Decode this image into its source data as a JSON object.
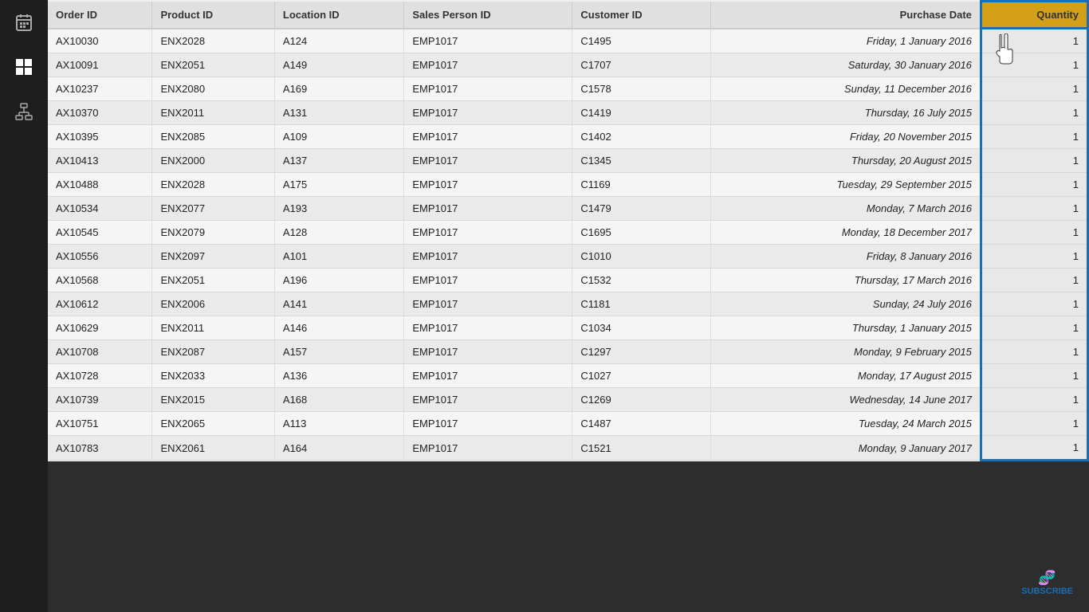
{
  "sidebar": {
    "icons": [
      {
        "name": "calendar-icon",
        "symbol": "📅"
      },
      {
        "name": "table-icon",
        "symbol": "⊞"
      },
      {
        "name": "hierarchy-icon",
        "symbol": "⊟"
      }
    ]
  },
  "table": {
    "columns": [
      {
        "key": "order_id",
        "label": "Order ID",
        "align": "left"
      },
      {
        "key": "product_id",
        "label": "Product ID",
        "align": "left"
      },
      {
        "key": "location_id",
        "label": "Location ID",
        "align": "left"
      },
      {
        "key": "sales_person_id",
        "label": "Sales Person ID",
        "align": "left"
      },
      {
        "key": "customer_id",
        "label": "Customer ID",
        "align": "left"
      },
      {
        "key": "purchase_date",
        "label": "Purchase Date",
        "align": "right"
      },
      {
        "key": "quantity",
        "label": "Quantity",
        "align": "right"
      }
    ],
    "rows": [
      {
        "order_id": "AX10030",
        "product_id": "ENX2028",
        "location_id": "A124",
        "sales_person_id": "EMP1017",
        "customer_id": "C1495",
        "purchase_date": "Friday, 1 January 2016",
        "quantity": "1"
      },
      {
        "order_id": "AX10091",
        "product_id": "ENX2051",
        "location_id": "A149",
        "sales_person_id": "EMP1017",
        "customer_id": "C1707",
        "purchase_date": "Saturday, 30 January 2016",
        "quantity": "1"
      },
      {
        "order_id": "AX10237",
        "product_id": "ENX2080",
        "location_id": "A169",
        "sales_person_id": "EMP1017",
        "customer_id": "C1578",
        "purchase_date": "Sunday, 11 December 2016",
        "quantity": "1"
      },
      {
        "order_id": "AX10370",
        "product_id": "ENX2011",
        "location_id": "A131",
        "sales_person_id": "EMP1017",
        "customer_id": "C1419",
        "purchase_date": "Thursday, 16 July 2015",
        "quantity": "1"
      },
      {
        "order_id": "AX10395",
        "product_id": "ENX2085",
        "location_id": "A109",
        "sales_person_id": "EMP1017",
        "customer_id": "C1402",
        "purchase_date": "Friday, 20 November 2015",
        "quantity": "1"
      },
      {
        "order_id": "AX10413",
        "product_id": "ENX2000",
        "location_id": "A137",
        "sales_person_id": "EMP1017",
        "customer_id": "C1345",
        "purchase_date": "Thursday, 20 August 2015",
        "quantity": "1"
      },
      {
        "order_id": "AX10488",
        "product_id": "ENX2028",
        "location_id": "A175",
        "sales_person_id": "EMP1017",
        "customer_id": "C1169",
        "purchase_date": "Tuesday, 29 September 2015",
        "quantity": "1"
      },
      {
        "order_id": "AX10534",
        "product_id": "ENX2077",
        "location_id": "A193",
        "sales_person_id": "EMP1017",
        "customer_id": "C1479",
        "purchase_date": "Monday, 7 March 2016",
        "quantity": "1"
      },
      {
        "order_id": "AX10545",
        "product_id": "ENX2079",
        "location_id": "A128",
        "sales_person_id": "EMP1017",
        "customer_id": "C1695",
        "purchase_date": "Monday, 18 December 2017",
        "quantity": "1"
      },
      {
        "order_id": "AX10556",
        "product_id": "ENX2097",
        "location_id": "A101",
        "sales_person_id": "EMP1017",
        "customer_id": "C1010",
        "purchase_date": "Friday, 8 January 2016",
        "quantity": "1"
      },
      {
        "order_id": "AX10568",
        "product_id": "ENX2051",
        "location_id": "A196",
        "sales_person_id": "EMP1017",
        "customer_id": "C1532",
        "purchase_date": "Thursday, 17 March 2016",
        "quantity": "1"
      },
      {
        "order_id": "AX10612",
        "product_id": "ENX2006",
        "location_id": "A141",
        "sales_person_id": "EMP1017",
        "customer_id": "C1181",
        "purchase_date": "Sunday, 24 July 2016",
        "quantity": "1"
      },
      {
        "order_id": "AX10629",
        "product_id": "ENX2011",
        "location_id": "A146",
        "sales_person_id": "EMP1017",
        "customer_id": "C1034",
        "purchase_date": "Thursday, 1 January 2015",
        "quantity": "1"
      },
      {
        "order_id": "AX10708",
        "product_id": "ENX2087",
        "location_id": "A157",
        "sales_person_id": "EMP1017",
        "customer_id": "C1297",
        "purchase_date": "Monday, 9 February 2015",
        "quantity": "1"
      },
      {
        "order_id": "AX10728",
        "product_id": "ENX2033",
        "location_id": "A136",
        "sales_person_id": "EMP1017",
        "customer_id": "C1027",
        "purchase_date": "Monday, 17 August 2015",
        "quantity": "1"
      },
      {
        "order_id": "AX10739",
        "product_id": "ENX2015",
        "location_id": "A168",
        "sales_person_id": "EMP1017",
        "customer_id": "C1269",
        "purchase_date": "Wednesday, 14 June 2017",
        "quantity": "1"
      },
      {
        "order_id": "AX10751",
        "product_id": "ENX2065",
        "location_id": "A113",
        "sales_person_id": "EMP1017",
        "customer_id": "C1487",
        "purchase_date": "Tuesday, 24 March 2015",
        "quantity": "1"
      },
      {
        "order_id": "AX10783",
        "product_id": "ENX2061",
        "location_id": "A164",
        "sales_person_id": "EMP1017",
        "customer_id": "C1521",
        "purchase_date": "Monday, 9 January 2017",
        "quantity": "1"
      }
    ]
  },
  "watermark": {
    "text": "SUBSCRIBE",
    "symbol": "🧬"
  }
}
